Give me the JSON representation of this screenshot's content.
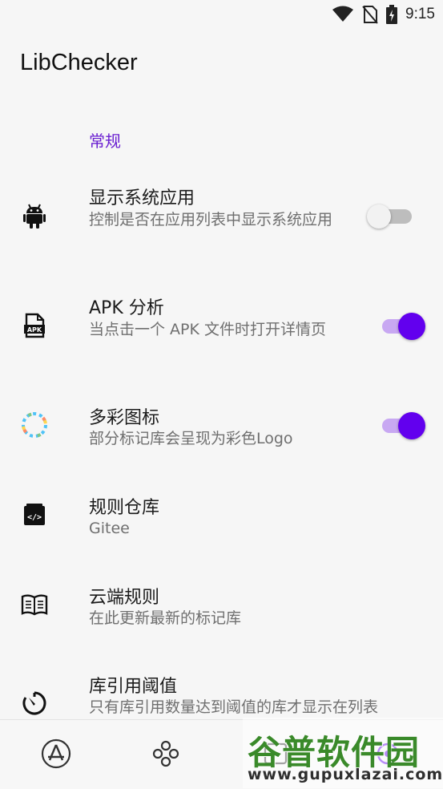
{
  "status": {
    "time": "9:15"
  },
  "app": {
    "title": "LibChecker"
  },
  "section": {
    "general": "常规"
  },
  "settings": [
    {
      "title": "显示系统应用",
      "summary": "控制是否在应用列表中显示系统应用",
      "toggle": "off",
      "icon": "android-icon"
    },
    {
      "title": "APK 分析",
      "summary": "当点击一个 APK 文件时打开详情页",
      "toggle": "on",
      "icon": "apk-file-icon"
    },
    {
      "title": "多彩图标",
      "summary": "部分标记库会呈现为彩色Logo",
      "toggle": "on",
      "icon": "colorful-ring-icon"
    },
    {
      "title": "规则仓库",
      "summary": "Gitee",
      "icon": "code-repository-icon"
    },
    {
      "title": "云端规则",
      "summary": "在此更新最新的标记库",
      "icon": "book-icon"
    },
    {
      "title": "库引用阈值",
      "summary": "只有库引用数量达到阈值的库才显示在列表",
      "icon": "timer-icon"
    }
  ],
  "bottom_nav": [
    {
      "name": "app-store-icon"
    },
    {
      "name": "library-icon"
    },
    {
      "name": "snapshot-icon"
    },
    {
      "name": "settings-icon"
    }
  ],
  "watermark": {
    "title": "谷普软件园",
    "url": "www.gupuxlazai.com"
  },
  "colors": {
    "accent": "#6200ee",
    "section_header": "#6a1fd1",
    "background": "#f6f6f6"
  }
}
